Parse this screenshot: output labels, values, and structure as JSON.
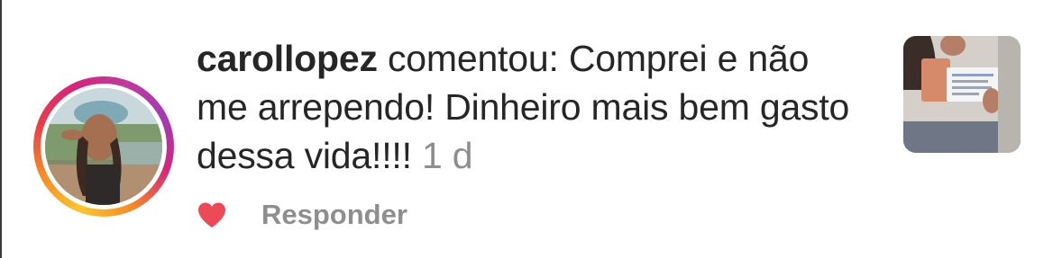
{
  "comment": {
    "username": "carollopez",
    "verb": "comentou:",
    "text": "Comprei e não me arrependo! Dinheiro mais bem gasto dessa vida!!!!",
    "time": "1 d"
  },
  "actions": {
    "like_icon": "heart-icon",
    "reply_label": "Responder"
  },
  "colors": {
    "heart": "#ed4956",
    "muted_text": "#8e8e8e",
    "primary_text": "#262626"
  }
}
